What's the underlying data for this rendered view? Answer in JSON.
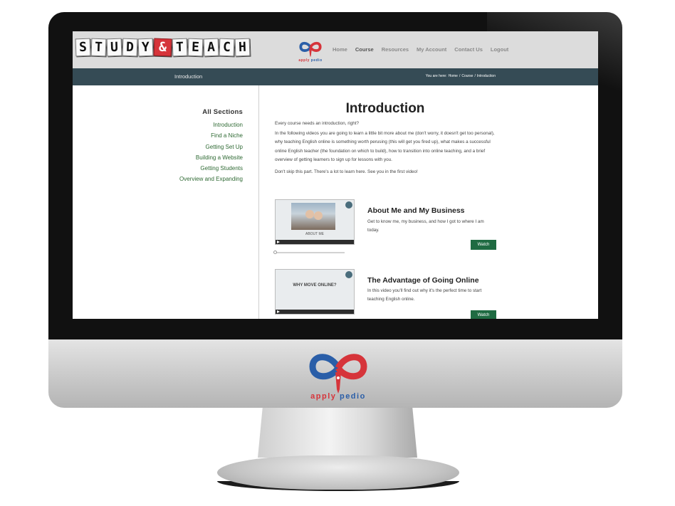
{
  "header": {
    "logo_tiles": [
      "S",
      "T",
      "U",
      "D",
      "Y",
      "&",
      "T",
      "E",
      "A",
      "C",
      "H"
    ],
    "brand_left": "apply",
    "brand_right": "pedio",
    "nav": [
      "Home",
      "Course",
      "Resources",
      "My Account",
      "Contact Us",
      "Logout"
    ],
    "nav_active": "Course"
  },
  "title_bar": {
    "page_title": "Introduction",
    "breadcrumb_prefix": "You are here:",
    "breadcrumb": [
      "Home",
      "Course",
      "Introduction"
    ],
    "background": "#354b55"
  },
  "sidebar": {
    "heading": "All Sections",
    "items": [
      "Introduction",
      "Find a Niche",
      "Getting Set Up",
      "Building a Website",
      "Getting Students",
      "Overview and Expanding"
    ]
  },
  "main": {
    "title": "Introduction",
    "paragraphs": [
      "Every course needs an introduction, right?",
      "In the following videos you are going to learn a little bit more about me (don't worry, it doesn't get too personal), why teaching English online is something worth perusing (this will get you fired up), what makes a successful online English teacher (the foundation on which to build), how to transition into online teaching, and a brief overview of getting learners to sign up for lessons with you.",
      "Don't skip this part. There's a lot to learn here. See you in the first video!"
    ],
    "videos": [
      {
        "title": "About Me and My Business",
        "description": "Get to know me, my business, and how I got to where I am today.",
        "thumb_caption": "ABOUT ME",
        "button": "Watch",
        "progress": 0
      },
      {
        "title": "The Advantage of Going Online",
        "description": "In this video you'll find out why it's the perfect time to start teaching English online.",
        "thumb_caption": "WHY MOVE ONLINE?",
        "button": "Watch"
      }
    ]
  },
  "colors": {
    "accent_green": "#1f6b42",
    "link_green": "#2f6a34",
    "brand_red": "#d6343a",
    "brand_blue": "#2a5ea8"
  },
  "icons": [
    "apply-pedio-logo-icon",
    "play-icon"
  ]
}
